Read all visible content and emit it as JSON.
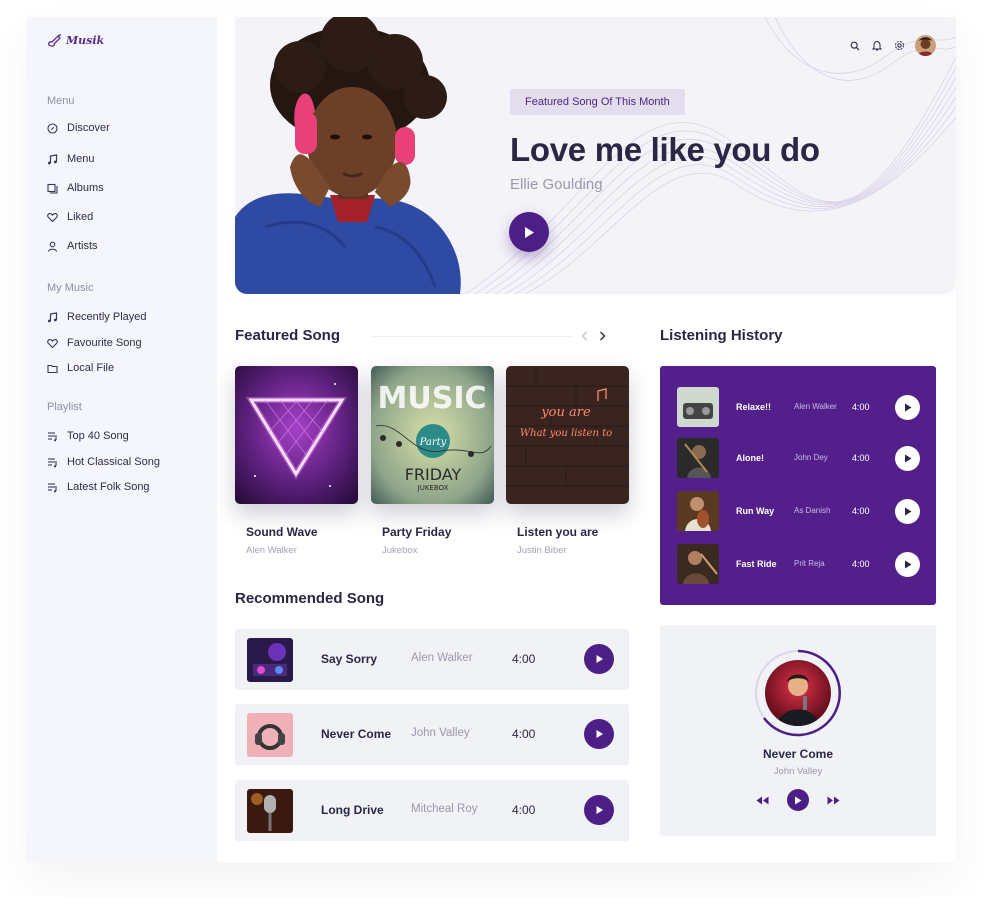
{
  "app": {
    "logo_text": "Musik"
  },
  "sidebar": {
    "menu": {
      "heading": "Menu",
      "items": [
        {
          "label": "Discover",
          "icon": "compass-icon"
        },
        {
          "label": "Menu",
          "icon": "music-note-icon"
        },
        {
          "label": "Albums",
          "icon": "albums-icon"
        },
        {
          "label": "Liked",
          "icon": "heart-icon"
        },
        {
          "label": "Artists",
          "icon": "user-icon"
        }
      ]
    },
    "my_music": {
      "heading": "My Music",
      "items": [
        {
          "label": "Recently Played",
          "icon": "music-note-icon"
        },
        {
          "label": "Favourite Song",
          "icon": "heart-icon"
        },
        {
          "label": "Local File",
          "icon": "folder-icon"
        }
      ]
    },
    "playlist": {
      "heading": "Playlist",
      "items": [
        {
          "label": "Top 40 Song",
          "icon": "playlist-icon"
        },
        {
          "label": "Hot Classical Song",
          "icon": "playlist-icon"
        },
        {
          "label": "Latest Folk Song",
          "icon": "playlist-icon"
        }
      ]
    }
  },
  "header": {
    "icons": [
      "search-icon",
      "bell-icon",
      "gear-icon"
    ]
  },
  "hero": {
    "badge": "Featured Song Of This Month",
    "title": "Love me like you do",
    "artist": "Ellie Goulding"
  },
  "featured": {
    "title": "Featured Song",
    "cards": [
      {
        "title": "Sound Wave",
        "artist": "Alen Walker"
      },
      {
        "title": "Party Friday",
        "artist": "Jukebox",
        "cover_text": [
          "MUSIC",
          "Party",
          "FRIDAY",
          "JUKEBOX"
        ]
      },
      {
        "title": "Listen you are",
        "artist": "Justin Biber",
        "cover_text": [
          "you are",
          "What you listen to"
        ]
      }
    ]
  },
  "recommended": {
    "title": "Recommended Song",
    "rows": [
      {
        "title": "Say Sorry",
        "artist": "Alen Walker",
        "duration": "4:00"
      },
      {
        "title": "Never Come",
        "artist": "John Valley",
        "duration": "4:00"
      },
      {
        "title": "Long Drive",
        "artist": "Mitcheal Roy",
        "duration": "4:00"
      }
    ]
  },
  "history": {
    "title": "Listening History",
    "rows": [
      {
        "title": "Relaxe!!",
        "artist": "Alen Walker",
        "duration": "4:00"
      },
      {
        "title": "Alone!",
        "artist": "John Dey",
        "duration": "4:00"
      },
      {
        "title": "Run Way",
        "artist": "As Danish",
        "duration": "4:00"
      },
      {
        "title": "Fast Ride",
        "artist": "Prit Reja",
        "duration": "4:00"
      }
    ]
  },
  "now_playing": {
    "title": "Never Come",
    "artist": "John Valley"
  },
  "colors": {
    "accent": "#4b1f86",
    "history_bg": "#53208b",
    "sidebar_bg": "#f4f6fb",
    "text_dark": "#2a2745",
    "text_muted": "#9a98aa"
  }
}
